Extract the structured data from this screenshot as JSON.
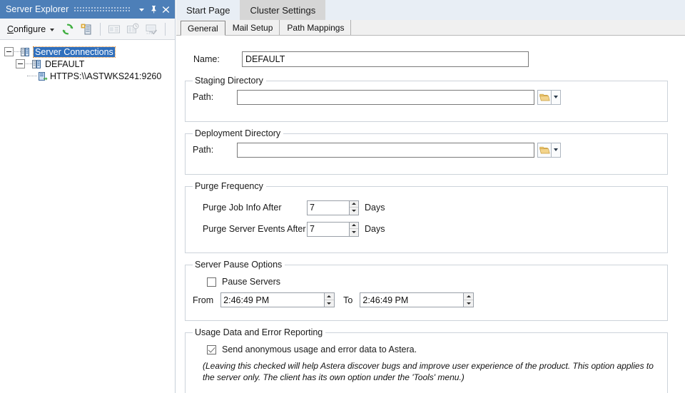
{
  "explorer": {
    "title": "Server Explorer",
    "titlebar_buttons": [
      {
        "name": "dropdown",
        "glyph": "▾"
      },
      {
        "name": "pin",
        "glyph": "📌"
      },
      {
        "name": "close",
        "glyph": "✕"
      }
    ],
    "toolbar": {
      "configure_label": "Configure",
      "configure_accelerator": "C",
      "icons": [
        {
          "name": "refresh-icon",
          "label": "Refresh",
          "enabled": true
        },
        {
          "name": "add-server-icon",
          "label": "Add Server Connection",
          "enabled": true
        },
        {
          "name": "server-properties-icon",
          "label": "Server Properties",
          "enabled": false
        },
        {
          "name": "server-monitor-icon",
          "label": "Server Monitor",
          "enabled": false
        },
        {
          "name": "server-tasks-icon",
          "label": "Server Tasks",
          "enabled": false
        }
      ]
    },
    "tree": {
      "root_label": "Server Connections",
      "root_selected": true,
      "child_label": "DEFAULT",
      "leaf_label": "HTTPS:\\\\ASTWKS241:9260"
    }
  },
  "document": {
    "tabs": [
      {
        "label": "Start Page",
        "active": false
      },
      {
        "label": "Cluster Settings",
        "active": true
      }
    ],
    "inner_tabs": [
      {
        "label": "General",
        "active": true
      },
      {
        "label": "Mail Setup",
        "active": false
      },
      {
        "label": "Path Mappings",
        "active": false
      }
    ]
  },
  "general": {
    "name": {
      "label": "Name:",
      "value": "DEFAULT",
      "placeholder": ""
    },
    "staging_directory": {
      "legend": "Staging Directory",
      "path_label": "Path:",
      "path_value": "",
      "path_placeholder": "",
      "browse_icon": "folder-icon"
    },
    "deployment_directory": {
      "legend": "Deployment Directory",
      "path_label": "Path:",
      "path_value": "",
      "path_placeholder": "",
      "browse_icon": "folder-icon"
    },
    "purge_frequency": {
      "legend": "Purge Frequency",
      "rows": [
        {
          "label": "Purge Job Info After",
          "value": "7",
          "unit": "Days"
        },
        {
          "label": "Purge Server Events After",
          "value": "7",
          "unit": "Days"
        }
      ]
    },
    "server_pause_options": {
      "legend": "Server Pause Options",
      "pause_checkbox_label": "Pause Servers",
      "pause_checked": false,
      "from_label": "From",
      "from_value": "2:46:49 PM",
      "to_label": "To",
      "to_value": "2:46:49 PM"
    },
    "usage_data": {
      "legend": "Usage Data and Error Reporting",
      "checkbox_label": "Send anonymous usage and error data to Astera.",
      "checked": true,
      "note": "(Leaving this checked will help Astera discover bugs and improve user experience of the product.  This option applies to the server only.  The client has its own option under the 'Tools' menu.)"
    }
  },
  "colors": {
    "dock_title_bg": "#4d7fb8",
    "tab_active_bg": "#d6d6d6",
    "tabstrip_bg": "#e8eef5",
    "tree_selection": "#2f6fbd",
    "group_border": "#cdd3da",
    "refresh_green": "#3fae3f",
    "folder_gold": "#e8bc5e"
  }
}
